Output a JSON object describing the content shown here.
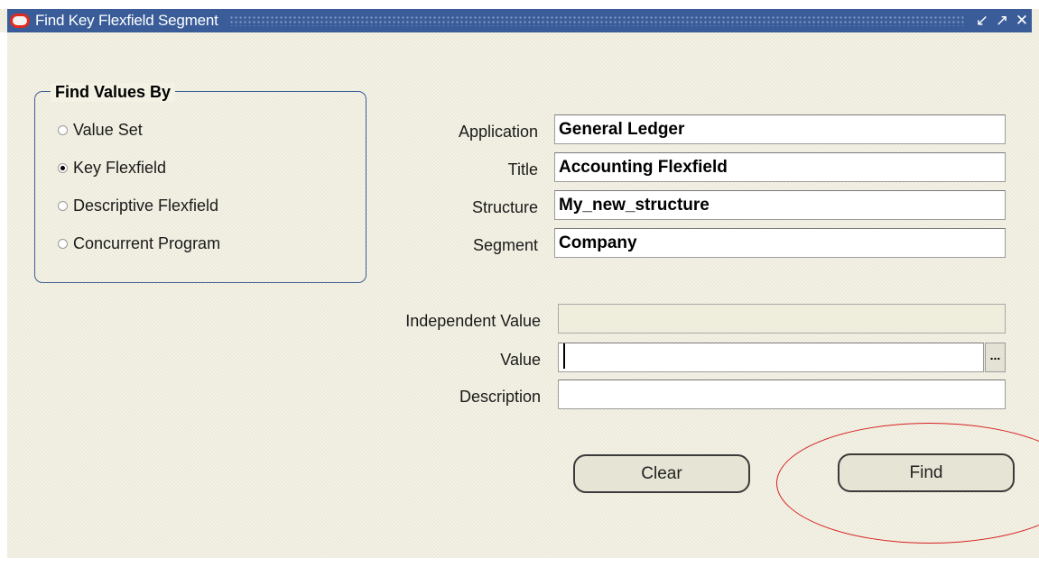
{
  "window": {
    "title": "Find Key Flexfield Segment",
    "controls": [
      "minimize-icon",
      "maximize-icon",
      "close-icon"
    ],
    "title_bar_color": "#3a5d99"
  },
  "find_values_by": {
    "title": "Find Values By",
    "options": [
      {
        "label": "Value Set",
        "checked": false
      },
      {
        "label": "Key Flexfield",
        "checked": true
      },
      {
        "label": "Descriptive Flexfield",
        "checked": false
      },
      {
        "label": "Concurrent Program",
        "checked": false
      }
    ]
  },
  "fields": {
    "application": {
      "label": "Application",
      "value": "General Ledger"
    },
    "title": {
      "label": "Title",
      "value": "Accounting Flexfield"
    },
    "structure": {
      "label": "Structure",
      "value": "My_new_structure"
    },
    "segment": {
      "label": "Segment",
      "value": "Company"
    },
    "independent_value": {
      "label": "Independent Value",
      "value": ""
    },
    "value": {
      "label": "Value",
      "value": ""
    },
    "description": {
      "label": "Description",
      "value": ""
    }
  },
  "lov_button": {
    "label": "..."
  },
  "buttons": {
    "clear": {
      "label": "Clear"
    },
    "find": {
      "label": "Find"
    }
  },
  "annotation": {
    "shape": "ellipse",
    "color": "#d62020",
    "target": "find-button"
  }
}
